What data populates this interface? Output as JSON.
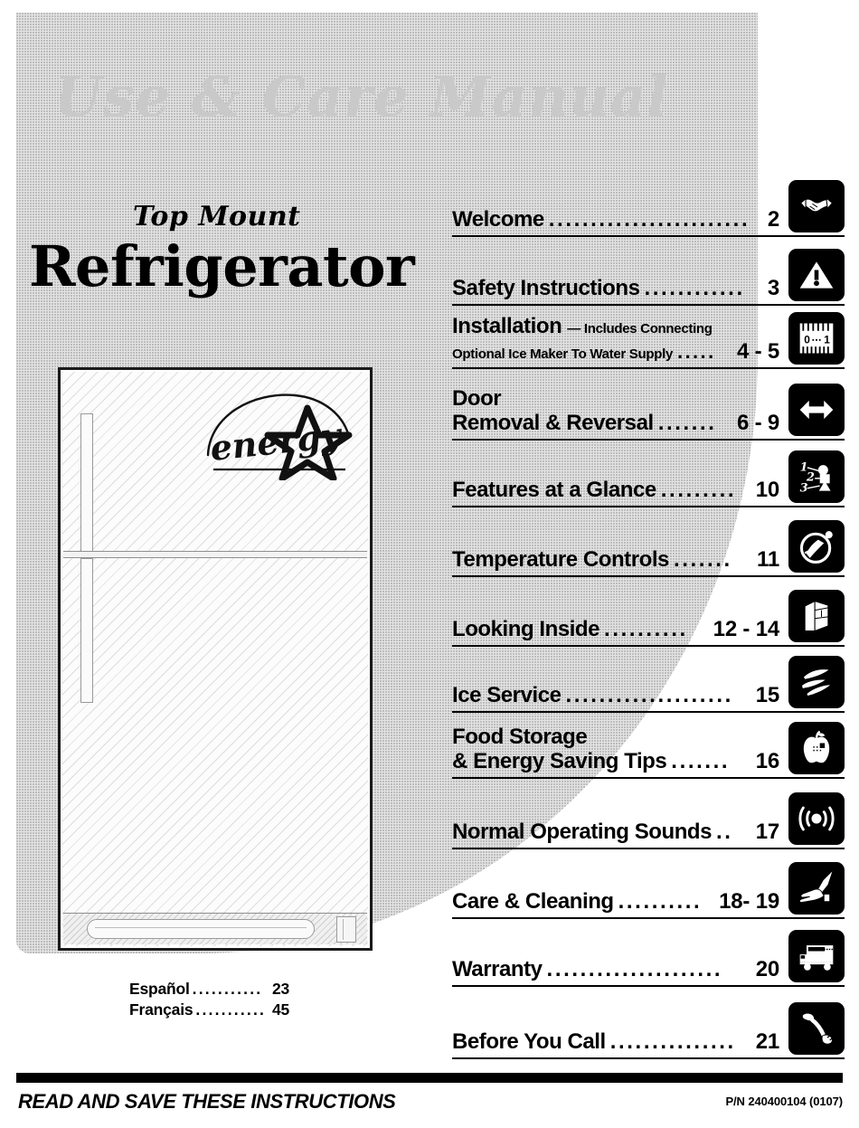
{
  "header": {
    "watermark": "Use & Care Manual"
  },
  "product": {
    "eyebrow": "Top Mount",
    "title": "Refrigerator",
    "energy_logo_text": "energy"
  },
  "languages": [
    {
      "name": "Español",
      "dots": "...........",
      "page": "23"
    },
    {
      "name": "Français",
      "dots": "...........",
      "page": "45"
    }
  ],
  "toc": {
    "items": [
      {
        "title": "Welcome",
        "subtitle": "",
        "line2": "",
        "dots": "........................",
        "page": "2",
        "icon": "handshake-icon"
      },
      {
        "title": "Safety Instructions",
        "subtitle": "",
        "line2": "",
        "dots": "............",
        "page": "3",
        "icon": "warning-triangle-icon"
      },
      {
        "title": "Installation",
        "subtitle": "— Includes Connecting",
        "line2": "Optional Ice Maker To Water Supply",
        "dots": ".....",
        "page": "4 - 5",
        "icon": "ruler-icon"
      },
      {
        "title": "Removal & Reversal",
        "subtitle": "",
        "line2": "Door",
        "dots": ".......",
        "page": "6 - 9",
        "icon": "double-arrow-icon"
      },
      {
        "title": "Features at a Glance",
        "subtitle": "",
        "line2": "",
        "dots": ".........",
        "page": "10",
        "icon": "numbered-list-icon"
      },
      {
        "title": "Temperature Controls",
        "subtitle": "",
        "line2": "",
        "dots": ".......",
        "page": "11",
        "icon": "control-dial-icon"
      },
      {
        "title": "Looking Inside",
        "subtitle": "",
        "line2": "",
        "dots": "..........",
        "page": "12 - 14",
        "icon": "open-refrigerator-icon"
      },
      {
        "title": "Ice Service",
        "subtitle": "",
        "line2": "",
        "dots": "....................",
        "page": "15",
        "icon": "ice-cubes-icon"
      },
      {
        "title": "& Energy Saving Tips",
        "subtitle": "",
        "line2": "Food Storage",
        "dots": ".......",
        "page": "16",
        "icon": "apple-icon"
      },
      {
        "title": "Normal Operating Sounds",
        "subtitle": "",
        "line2": "",
        "dots": "..",
        "page": "17",
        "icon": "sound-waves-icon"
      },
      {
        "title": "Care & Cleaning",
        "subtitle": "",
        "line2": "",
        "dots": "..........",
        "page": "18- 19",
        "icon": "cleaning-hand-icon"
      },
      {
        "title": "Warranty",
        "subtitle": "",
        "line2": "",
        "dots": ".....................",
        "page": "20",
        "icon": "delivery-truck-icon"
      },
      {
        "title": "Before You Call",
        "subtitle": "",
        "line2": "",
        "dots": "...............",
        "page": "21",
        "icon": "telephone-icon"
      }
    ]
  },
  "footer": {
    "notice": "READ AND SAVE THESE INSTRUCTIONS",
    "part_number": "P/N 240400104   (0107)"
  },
  "colors": {
    "ink": "#000000",
    "background": "#ffffff",
    "halftone_gray": "#e4e4e4",
    "watermark_gray": "#c9c9c9"
  }
}
